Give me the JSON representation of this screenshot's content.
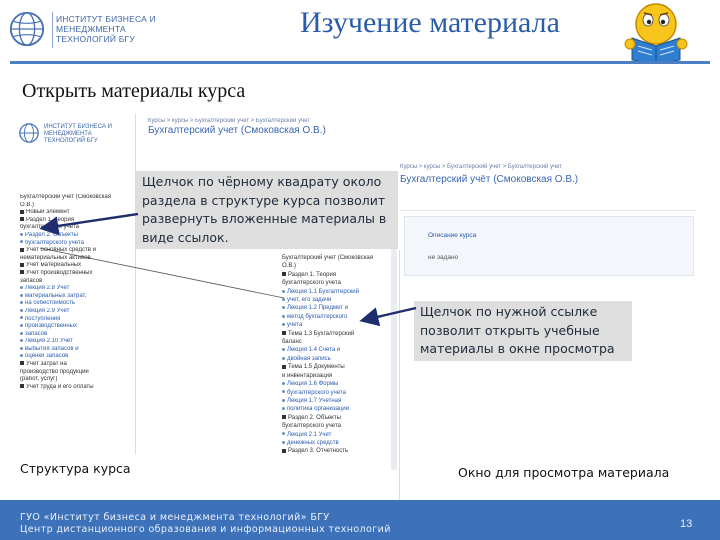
{
  "header": {
    "logo_text": "Институт бизнеса и менеджмента технологий БГУ",
    "title": "Изучение материала"
  },
  "section_heading": "Открыть материалы курса",
  "left_shot": {
    "logo_text": "Институт бизнеса и менеджмента технологий БГУ",
    "breadcrumb": "Курсы > курсы > Бухгалтерский учет > Бухгалтерский учет",
    "course_title": "Бухгалтерский учет (Смоковская О.В.)",
    "tree": [
      {
        "label": "Бухгалтерский учет (Смоковская",
        "kind": "text"
      },
      {
        "label": "О.В.)",
        "kind": "text"
      },
      {
        "label": "Новый элемент",
        "kind": "marker"
      },
      {
        "label": "Раздел 1. Теория",
        "kind": "marker"
      },
      {
        "label": "бухгалтерского учета",
        "kind": "text"
      },
      {
        "label": "Раздел 2. Объекты",
        "kind": "link"
      },
      {
        "label": "бухгалтерского учета",
        "kind": "link"
      },
      {
        "label": "Учет основных средств и",
        "kind": "marker"
      },
      {
        "label": "нематериальных активов",
        "kind": "text"
      },
      {
        "label": "Учет материальных",
        "kind": "marker"
      },
      {
        "label": "Учет производственных",
        "kind": "marker"
      },
      {
        "label": "запасов",
        "kind": "text"
      },
      {
        "label": "Лекция 2.8 Учет",
        "kind": "link"
      },
      {
        "label": "материальных затрат,",
        "kind": "link"
      },
      {
        "label": "на себестоимость",
        "kind": "link"
      },
      {
        "label": "Лекция 2.9 Учет",
        "kind": "link"
      },
      {
        "label": "поступления",
        "kind": "link"
      },
      {
        "label": "производственных",
        "kind": "link"
      },
      {
        "label": "запасов",
        "kind": "link"
      },
      {
        "label": "Лекция 2.10 Учет",
        "kind": "link"
      },
      {
        "label": "выбытия запасов и",
        "kind": "link"
      },
      {
        "label": "оценки запасов",
        "kind": "link"
      },
      {
        "label": "Учет затрат на",
        "kind": "marker"
      },
      {
        "label": "производство продукции",
        "kind": "text"
      },
      {
        "label": "(работ, услуг)",
        "kind": "text"
      },
      {
        "label": "Учет труда и его оплаты",
        "kind": "marker"
      }
    ]
  },
  "callout_1": "Щелчок по чёрному квадрату около раздела в структуре курса позволит развернуть вложенные материалы в виде ссылок.",
  "callout_2": "Щелчок по нужной ссылке позволит открыть учебные материалы в окне просмотра",
  "right_shot": {
    "breadcrumb": "Курсы > курсы > Бухгалтерский учет > Бухгалтерский учет",
    "course_title": "Бухгалтерский учёт (Смоковская О.В.)",
    "link": "Описание курса",
    "meta": "не задано",
    "tree": [
      {
        "label": "Бухгалтерский учет (Смоковская",
        "kind": "text"
      },
      {
        "label": "О.В.)",
        "kind": "text"
      },
      {
        "label": "Раздел 1. Теория",
        "kind": "marker"
      },
      {
        "label": "бухгалтерского учета",
        "kind": "text"
      },
      {
        "label": "Лекция 1.1 Бухгалтерский",
        "kind": "link"
      },
      {
        "label": "учет, его задачи",
        "kind": "link"
      },
      {
        "label": "Лекция 1.2 Предмет и",
        "kind": "link"
      },
      {
        "label": "метод бухгалтерского",
        "kind": "link"
      },
      {
        "label": "учета",
        "kind": "link"
      },
      {
        "label": "Тема 1.3 Бухгалтерский",
        "kind": "marker"
      },
      {
        "label": "баланс",
        "kind": "text"
      },
      {
        "label": "Лекция 1.4 Счета и",
        "kind": "link"
      },
      {
        "label": "двойная запись",
        "kind": "link"
      },
      {
        "label": "Тема 1.5 Документы",
        "kind": "marker"
      },
      {
        "label": "и инвентаризация",
        "kind": "text"
      },
      {
        "label": "Лекция 1.6 Формы",
        "kind": "link"
      },
      {
        "label": "бухгалтерского учета",
        "kind": "link"
      },
      {
        "label": "Лекция 1.7 Учетная",
        "kind": "link"
      },
      {
        "label": "политика организации",
        "kind": "link"
      },
      {
        "label": "Раздел 2. Объекты",
        "kind": "marker"
      },
      {
        "label": "бухгалтерского учета",
        "kind": "text"
      },
      {
        "label": "Лекция 2.1 Учет",
        "kind": "link"
      },
      {
        "label": "денежных средств",
        "kind": "link"
      },
      {
        "label": "Раздел 3. Отчетность",
        "kind": "marker"
      }
    ]
  },
  "captions": {
    "left": "Структура курса",
    "right": "Окно для просмотра материала"
  },
  "footer": {
    "line1": "ГУО «Институт бизнеса и менеджмента технологий» БГУ",
    "line2": "Центр дистанционного образования и информационных технологий",
    "page": "13"
  },
  "colors": {
    "title": "#2a5da8",
    "bar": "#4a7fc4",
    "footer": "#3d72ba",
    "callout_bg": "#dedede",
    "link": "#2b5cae"
  }
}
